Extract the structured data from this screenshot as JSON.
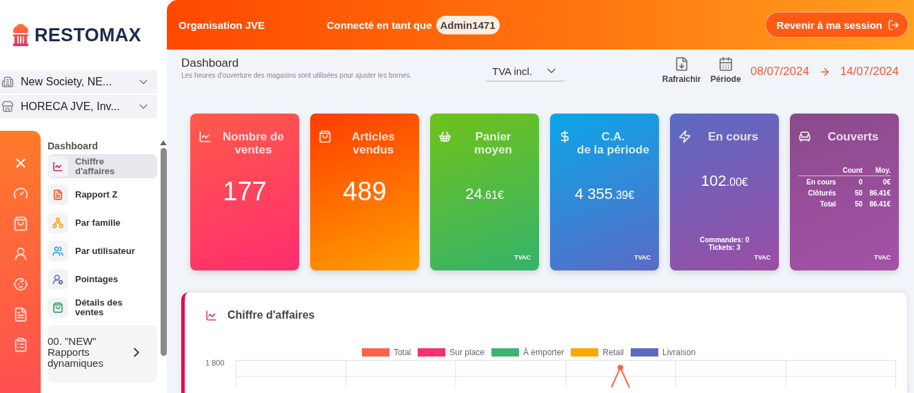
{
  "sidebar": {
    "logo": "RESTOMAX",
    "selectors": [
      {
        "kind": "company",
        "label": "New Society, NE..."
      },
      {
        "kind": "store",
        "label": "HORECA JVE, Inv..."
      }
    ],
    "menu": {
      "heading": "Dashboard",
      "items": [
        {
          "kind": "chart",
          "label": "Chiffre d'affaires",
          "selected": true
        },
        {
          "kind": "report",
          "label": "Rapport Z",
          "selected": false
        },
        {
          "kind": "family",
          "label": "Par famille",
          "selected": false
        },
        {
          "kind": "users",
          "label": "Par utilisateur",
          "selected": false
        },
        {
          "kind": "clock",
          "label": "Pointages",
          "selected": false
        },
        {
          "kind": "bag",
          "label": "Détails des ventes",
          "selected": false
        }
      ],
      "dynamic_reports": "00. \"NEW\" Rapports dynamiques"
    }
  },
  "header": {
    "organisation": "Organisation JVE",
    "connected_label": "Connecté en tant que",
    "user": "Admin1471",
    "return_button": "Revenir à ma session"
  },
  "toolbar": {
    "title": "Dashboard",
    "subtitle": "Les heures d'ouverture des magasins sont utilisées pour ajuster les bornes.",
    "vat_select": "TVA incl.",
    "actions": [
      {
        "kind": "refresh",
        "label": "Rafraichir"
      },
      {
        "kind": "period",
        "label": "Période"
      }
    ],
    "date_from": "08/07/2024",
    "date_to": "14/07/2024"
  },
  "cards": [
    {
      "kind": "stat",
      "title_lines": [
        "Nombre de",
        "ventes"
      ],
      "value_main": "177"
    },
    {
      "kind": "stat",
      "title_lines": [
        "Articles",
        "vendus"
      ],
      "value_main": "489"
    },
    {
      "kind": "stat",
      "title_lines": [
        "Panier",
        "moyen"
      ],
      "value_main": "24",
      "value_decimals": ".61€",
      "vat": "TVAC"
    },
    {
      "kind": "stat",
      "title_lines": [
        "C.A.",
        "de la période"
      ],
      "value_main": "4 355",
      "value_decimals": ".39€",
      "vat": "TVAC"
    },
    {
      "kind": "stat",
      "title_lines": [
        "En cours"
      ],
      "value_main": "102",
      "value_decimals": ".00€",
      "notes": [
        "Commandes: 0",
        "Tickets: 3"
      ],
      "vat": "TVAC"
    },
    {
      "kind": "table",
      "title_lines": [
        "Couverts"
      ],
      "columns": [
        "",
        "Count",
        "Moy."
      ],
      "rows": [
        [
          "En cours",
          "0",
          "0€"
        ],
        [
          "Clôturés",
          "50",
          "86.41€"
        ],
        [
          "Total",
          "50",
          "86.41€"
        ]
      ],
      "vat": "TVAC"
    }
  ],
  "chart": {
    "title": "Chiffre d'affaires",
    "legend": [
      {
        "label": "Total",
        "color": "#ff6347"
      },
      {
        "label": "Sur place",
        "color": "#f5306f"
      },
      {
        "label": "À emporter",
        "color": "#3cb371"
      },
      {
        "label": "Retail",
        "color": "#ffa500"
      },
      {
        "label": "Livraison",
        "color": "#5c6bc0"
      }
    ],
    "y_tick": "1 800"
  }
}
